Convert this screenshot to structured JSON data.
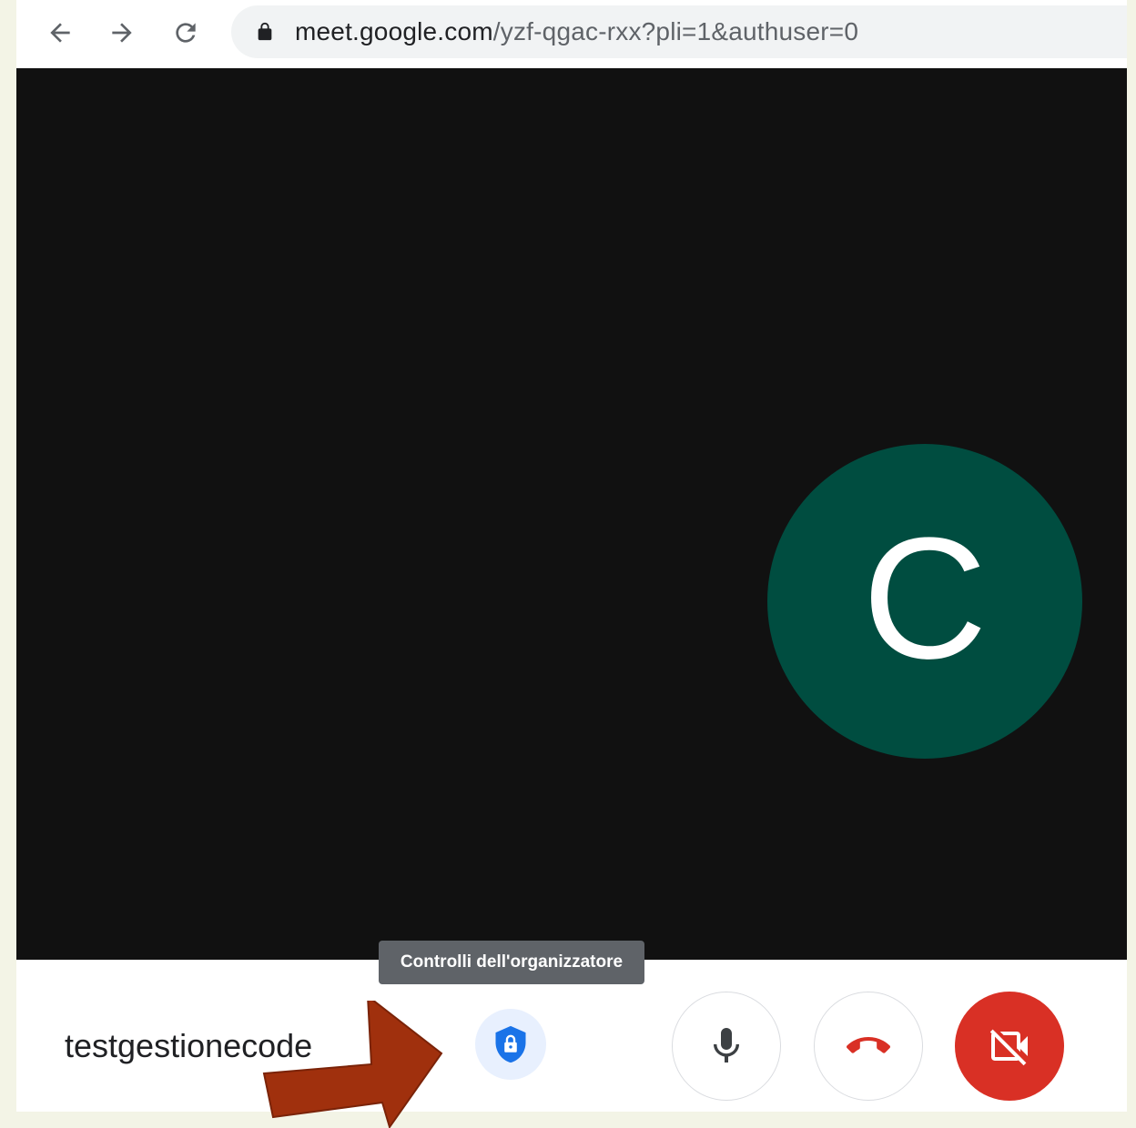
{
  "browser": {
    "url_host": "meet.google.com",
    "url_path": "/yzf-qgac-rxx?pli=1&authuser=0",
    "icons": {
      "back": "arrow-left-icon",
      "forward": "arrow-right-icon",
      "reload": "reload-icon",
      "secure": "lock-icon"
    }
  },
  "meeting": {
    "participant_initial": "C",
    "avatar_color": "#004d40",
    "background_color": "#111111"
  },
  "controls": {
    "meeting_name": "testgestionecode",
    "host_controls_tooltip": "Controlli dell'organizzatore",
    "icons": {
      "host_controls": "shield-lock-icon",
      "mic": "microphone-icon",
      "hangup": "phone-hangup-icon",
      "camera": "camera-off-icon"
    },
    "colors": {
      "host_controls_bg": "#e8f0fe",
      "host_controls_icon": "#1a73e8",
      "hangup_icon": "#d93025",
      "camera_off_bg": "#d93025"
    }
  },
  "annotation": {
    "arrow_color": "#a0300d"
  }
}
